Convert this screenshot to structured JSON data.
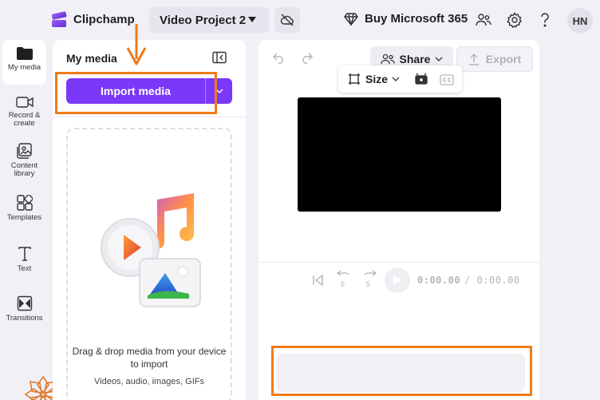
{
  "topbar": {
    "app_name": "Clipchamp",
    "project_name": "Video Project 2",
    "buy_label": "Buy Microsoft 365",
    "avatar_initials": "HN",
    "icons": [
      "clipchamp-logo",
      "cloud-off-icon",
      "diamond-icon",
      "people-icon",
      "gear-icon",
      "help-icon"
    ]
  },
  "rail": {
    "items": [
      {
        "label": "My media",
        "icon": "folder-icon",
        "active": true
      },
      {
        "label": "Record & create",
        "icon": "camera-icon"
      },
      {
        "label": "Content library",
        "icon": "library-icon"
      },
      {
        "label": "Templates",
        "icon": "templates-icon"
      },
      {
        "label": "Text",
        "icon": "text-icon"
      },
      {
        "label": "Transitions",
        "icon": "transitions-icon"
      }
    ]
  },
  "media_panel": {
    "title": "My media",
    "import_label": "Import media",
    "drop_title": "Drag & drop media from your device to import",
    "drop_subtitle": "Videos, audio, images, GIFs"
  },
  "preview": {
    "share_label": "Share",
    "export_label": "Export",
    "size_label": "Size",
    "time_current": "0:00.00",
    "time_total": "/ 0:00.00",
    "skip_back_seconds": "5",
    "skip_forward_seconds": "5"
  },
  "colors": {
    "accent": "#7a38f8",
    "annotation": "#f07b1a",
    "background": "#f1f0f6"
  }
}
